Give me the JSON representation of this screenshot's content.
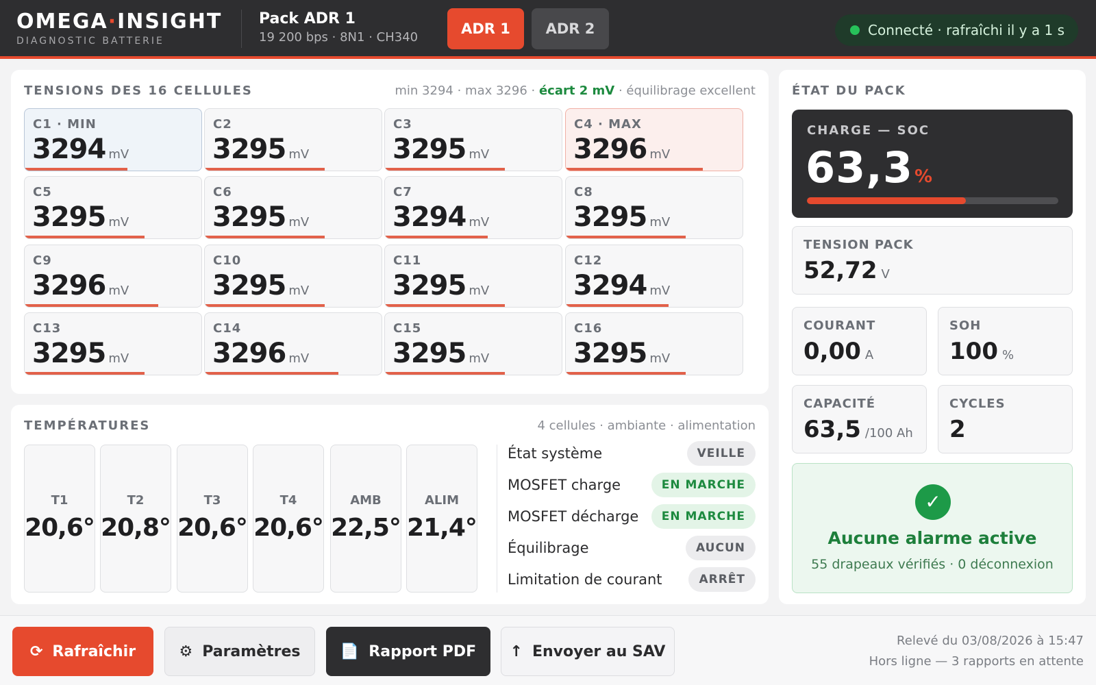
{
  "header": {
    "brand_left": "OMEGA",
    "brand_dot": "·",
    "brand_right": "INSIGHT",
    "brand_sub": "DIAGNOSTIC BATTERIE",
    "pack_title": "Pack ADR 1",
    "pack_sub": "19 200 bps · 8N1 · CH340",
    "tabs": [
      {
        "label": "ADR 1",
        "active": true
      },
      {
        "label": "ADR 2",
        "active": false
      }
    ],
    "status": "Connecté · rafraîchi il y a 1 s"
  },
  "cells_panel": {
    "title": "TENSIONS DES 16 CELLULES",
    "meta_prefix": "min 3294 · max 3296 ·",
    "meta_highlight": "écart 2 mV",
    "meta_suffix": "· équilibrage excellent",
    "unit": "mV",
    "cells": [
      {
        "label": "C1 · MIN",
        "value": "3294",
        "level": 0.6,
        "state": "min"
      },
      {
        "label": "C2",
        "value": "3295",
        "level": 0.7,
        "state": ""
      },
      {
        "label": "C3",
        "value": "3295",
        "level": 0.7,
        "state": ""
      },
      {
        "label": "C4 · MAX",
        "value": "3296",
        "level": 0.8,
        "state": "max"
      },
      {
        "label": "C5",
        "value": "3295",
        "level": 0.7,
        "state": ""
      },
      {
        "label": "C6",
        "value": "3295",
        "level": 0.7,
        "state": ""
      },
      {
        "label": "C7",
        "value": "3294",
        "level": 0.6,
        "state": ""
      },
      {
        "label": "C8",
        "value": "3295",
        "level": 0.7,
        "state": ""
      },
      {
        "label": "C9",
        "value": "3296",
        "level": 0.78,
        "state": ""
      },
      {
        "label": "C10",
        "value": "3295",
        "level": 0.7,
        "state": ""
      },
      {
        "label": "C11",
        "value": "3295",
        "level": 0.7,
        "state": ""
      },
      {
        "label": "C12",
        "value": "3294",
        "level": 0.6,
        "state": ""
      },
      {
        "label": "C13",
        "value": "3295",
        "level": 0.7,
        "state": ""
      },
      {
        "label": "C14",
        "value": "3296",
        "level": 0.78,
        "state": ""
      },
      {
        "label": "C15",
        "value": "3295",
        "level": 0.7,
        "state": ""
      },
      {
        "label": "C16",
        "value": "3295",
        "level": 0.7,
        "state": ""
      }
    ]
  },
  "temps_panel": {
    "title": "TEMPÉRATURES",
    "meta": "4 cellules · ambiante · alimentation",
    "sensors": [
      {
        "name": "T1",
        "value": "20,6°"
      },
      {
        "name": "T2",
        "value": "20,8°"
      },
      {
        "name": "T3",
        "value": "20,6°"
      },
      {
        "name": "T4",
        "value": "20,6°"
      },
      {
        "name": "AMB",
        "value": "22,5°"
      },
      {
        "name": "ALIM",
        "value": "21,4°"
      }
    ],
    "system": [
      {
        "label": "État système",
        "status": "VEILLE",
        "tone": "grey"
      },
      {
        "label": "MOSFET charge",
        "status": "EN MARCHE",
        "tone": "green"
      },
      {
        "label": "MOSFET décharge",
        "status": "EN MARCHE",
        "tone": "green"
      },
      {
        "label": "Équilibrage",
        "status": "AUCUN",
        "tone": "grey"
      },
      {
        "label": "Limitation de courant",
        "status": "ARRÊT",
        "tone": "grey"
      }
    ]
  },
  "state_panel": {
    "title": "ÉTAT DU PACK",
    "soc_label": "CHARGE — SOC",
    "soc_value": "63,3",
    "soc_unit": "%",
    "soc_fraction": 0.633,
    "tension_label": "TENSION PACK",
    "tension_value": "52,72",
    "tension_unit": "V",
    "courant_label": "COURANT",
    "courant_value": "0,00",
    "courant_unit": "A",
    "soh_label": "SOH",
    "soh_value": "100",
    "soh_unit": "%",
    "capacite_label": "CAPACITÉ",
    "capacite_value": "63,5",
    "capacite_unit": "/100 Ah",
    "cycles_label": "CYCLES",
    "cycles_value": "2",
    "alarm_icon": "✓",
    "alarm_title": "Aucune alarme active",
    "alarm_sub": "55 drapeaux vérifiés · 0 déconnexion"
  },
  "footer": {
    "refresh": {
      "icon": "⟳",
      "label": "Rafraîchir"
    },
    "params": {
      "icon": "⚙",
      "label": "Paramètres"
    },
    "pdf": {
      "icon": "📄",
      "label": "Rapport PDF"
    },
    "sav": {
      "icon": "↑",
      "label": "Envoyer au SAV"
    },
    "releve": "Relevé du 03/08/2026 à 15:47",
    "offline": "Hors ligne — 3 rapports en attente"
  },
  "colors": {
    "accent": "#e64a2e",
    "header_bg": "#2e2e30",
    "ok_green": "#1d8a3f",
    "status_dot": "#27c15a"
  }
}
